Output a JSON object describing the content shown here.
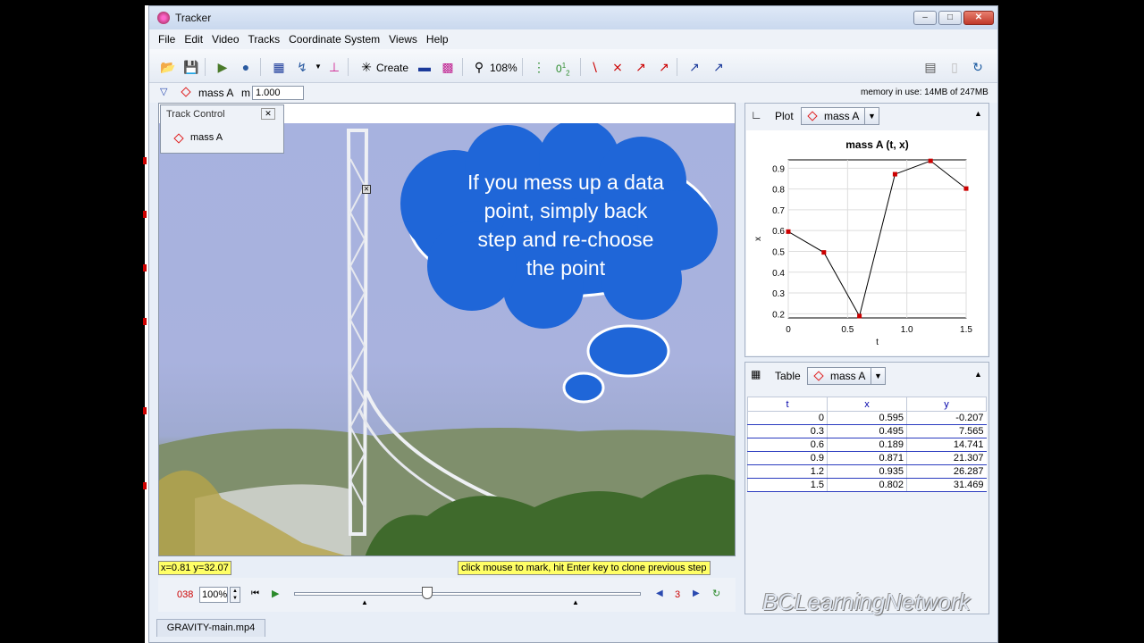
{
  "window": {
    "title": "Tracker"
  },
  "menu": [
    "File",
    "Edit",
    "Video",
    "Tracks",
    "Coordinate System",
    "Views",
    "Help"
  ],
  "toolbar": {
    "create_label": "Create",
    "zoom_label": "108%",
    "step_label": "0",
    "step_sub": "1",
    "step_sub2": "2"
  },
  "trackbar": {
    "track_name": "mass A",
    "mass_label": "m",
    "mass_value": "1.000",
    "memory": "memory in use: 14MB of 247MB"
  },
  "track_control": {
    "title": "Track Control",
    "item": "mass A"
  },
  "bubble": {
    "text": "If you mess up a data point, simply back step and re-choose the point"
  },
  "status": {
    "coords": "x=0.81  y=32.07",
    "hint": "click mouse to mark, hit Enter key to clone previous step"
  },
  "player": {
    "frame": "038",
    "rate": "100%",
    "step_size": "3"
  },
  "file_tab": "GRAVITY-main.mp4",
  "plot_panel": {
    "label": "Plot",
    "track": "mass A"
  },
  "table_panel": {
    "label": "Table",
    "track": "mass A",
    "columns": [
      "t",
      "x",
      "y"
    ],
    "rows": [
      [
        "0",
        "0.595",
        "-0.207"
      ],
      [
        "0.3",
        "0.495",
        "7.565"
      ],
      [
        "0.6",
        "0.189",
        "14.741"
      ],
      [
        "0.9",
        "0.871",
        "21.307"
      ],
      [
        "1.2",
        "0.935",
        "26.287"
      ],
      [
        "1.5",
        "0.802",
        "31.469"
      ]
    ]
  },
  "watermark": "BCLearningNetwork",
  "chart_data": {
    "type": "line",
    "title": "mass A (t, x)",
    "xlabel": "t",
    "ylabel": "x",
    "x": [
      0,
      0.3,
      0.6,
      0.9,
      1.2,
      1.5
    ],
    "series": [
      {
        "values": [
          0.595,
          0.495,
          0.189,
          0.871,
          0.935,
          0.802
        ]
      }
    ],
    "xlim": [
      0,
      1.5
    ],
    "ylim": [
      0.18,
      0.94
    ],
    "xticks": [
      "0",
      "0.5",
      "1.0",
      "1.5"
    ],
    "yticks": [
      "0.2",
      "0.3",
      "0.4",
      "0.5",
      "0.6",
      "0.7",
      "0.8",
      "0.9"
    ],
    "grid": true,
    "marker_color": "#cc0000"
  }
}
